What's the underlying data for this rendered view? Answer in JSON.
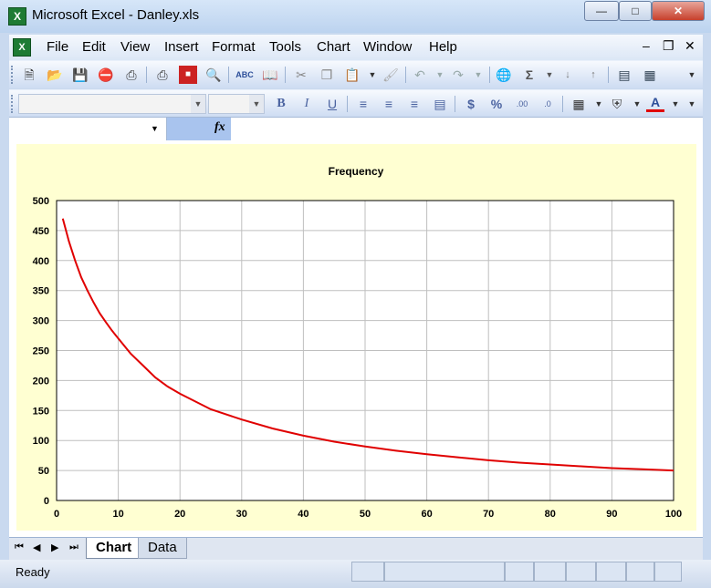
{
  "window": {
    "title": "Microsoft Excel - Danley.xls"
  },
  "menu": {
    "items": [
      "File",
      "Edit",
      "View",
      "Insert",
      "Format",
      "Tools",
      "Chart",
      "Window",
      "Help"
    ]
  },
  "toolbar": {
    "standard": [
      "new-icon",
      "open-icon",
      "save-icon",
      "permission-icon",
      "print-preview-icon",
      "print-icon",
      "research-icon",
      "find-icon",
      "spelling-icon",
      "research-book-icon",
      "cut-icon",
      "copy-icon",
      "paste-icon",
      "format-painter-icon",
      "undo-icon",
      "redo-icon",
      "hyperlink-icon",
      "autosum-icon",
      "sort-asc-icon",
      "sort-desc-icon",
      "chart-wizard-icon",
      "drawing-icon"
    ],
    "formatting": {
      "bold": "B",
      "italic": "I",
      "underline": "U",
      "currency": "$",
      "percent": "%",
      "increase_decimal": ".00",
      "decrease_decimal": ".0"
    }
  },
  "formula_bar": {
    "fx_label": "fx"
  },
  "chart_data": {
    "type": "line",
    "title": "Frequency",
    "xlabel": "",
    "ylabel": "",
    "xlim": [
      0,
      100
    ],
    "ylim": [
      0,
      500
    ],
    "xticks": [
      0,
      10,
      20,
      30,
      40,
      50,
      60,
      70,
      80,
      90,
      100
    ],
    "yticks": [
      0,
      50,
      100,
      150,
      200,
      250,
      300,
      350,
      400,
      450,
      500
    ],
    "grid": true,
    "legend": "none",
    "series": [
      {
        "color": "#e00000",
        "x": [
          1,
          2,
          3,
          4,
          5,
          6,
          7,
          8,
          9,
          10,
          12,
          14,
          16,
          18,
          20,
          25,
          30,
          35,
          40,
          45,
          50,
          55,
          60,
          65,
          70,
          75,
          80,
          85,
          90,
          95,
          100
        ],
        "y": [
          470,
          432,
          400,
          372,
          350,
          330,
          312,
          297,
          283,
          270,
          245,
          225,
          205,
          190,
          178,
          152,
          135,
          120,
          108,
          98,
          90,
          83,
          77,
          72,
          67,
          63,
          60,
          57,
          54,
          52,
          50
        ]
      }
    ]
  },
  "tabs": [
    {
      "label": "Chart",
      "active": true
    },
    {
      "label": "Data",
      "active": false
    }
  ],
  "status": {
    "text": "Ready"
  }
}
